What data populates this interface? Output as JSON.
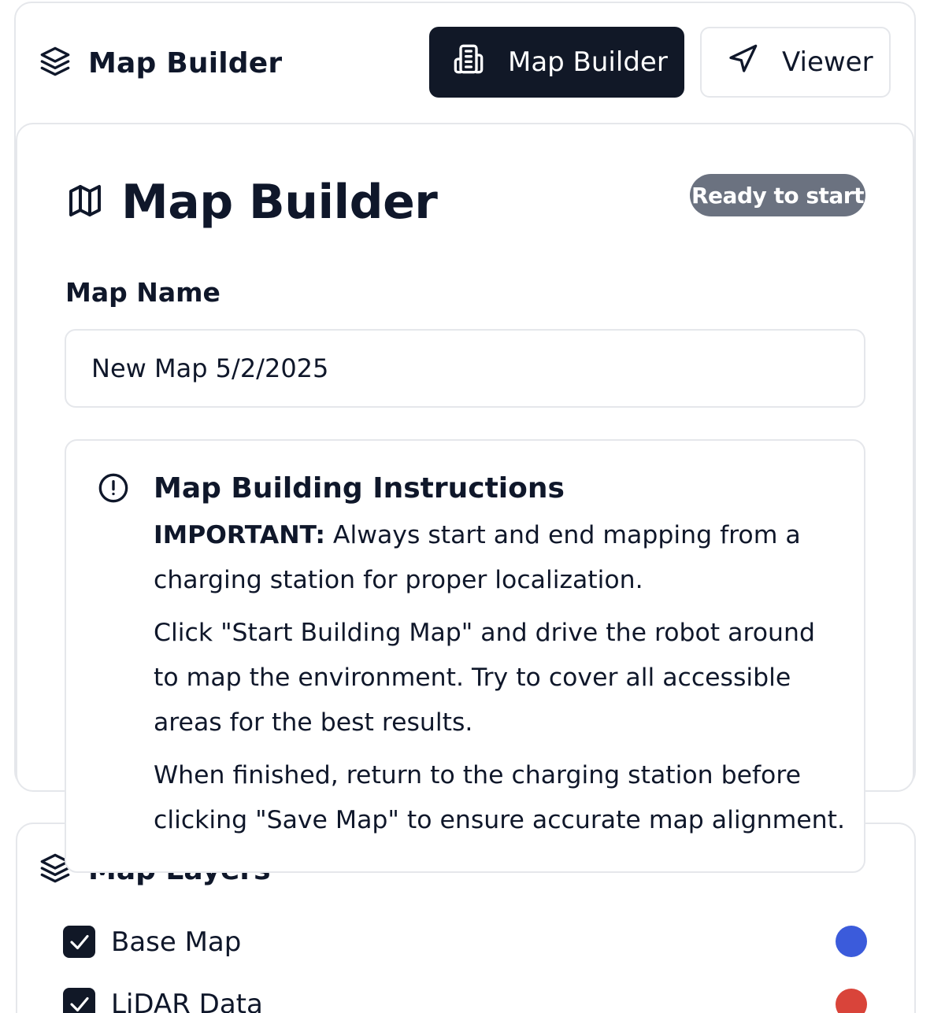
{
  "header": {
    "brand_title": "Map Builder",
    "nav": [
      {
        "label": "Map Builder",
        "icon": "document-icon",
        "active": true
      },
      {
        "label": "Viewer",
        "icon": "navigation-icon",
        "active": false
      }
    ]
  },
  "builder": {
    "title": "Map Builder",
    "title_icon": "map-icon",
    "status": "Ready to start",
    "map_name_label": "Map Name",
    "map_name_value": "New Map 5/2/2025"
  },
  "instructions": {
    "icon": "alert-circle-icon",
    "title": "Map Building Instructions",
    "important_label": "IMPORTANT:",
    "important_text": " Always start and end mapping from a charging station for proper localization.",
    "paragraph_2": "Click \"Start Building Map\" and drive the robot around to map the environment. Try to cover all accessible areas for the best results.",
    "paragraph_3": "When finished, return to the charging station before clicking \"Save Map\" to ensure accurate map alignment."
  },
  "layers": {
    "title": "Map Layers",
    "icon": "layers-icon",
    "items": [
      {
        "label": "Base Map",
        "checked": true,
        "color": "#3b5bdb"
      },
      {
        "label": "LiDAR Data",
        "checked": true,
        "color": "#d9443a"
      }
    ]
  },
  "colors": {
    "dark": "#111827",
    "border": "#e5e7eb",
    "badge": "#6b7280"
  }
}
